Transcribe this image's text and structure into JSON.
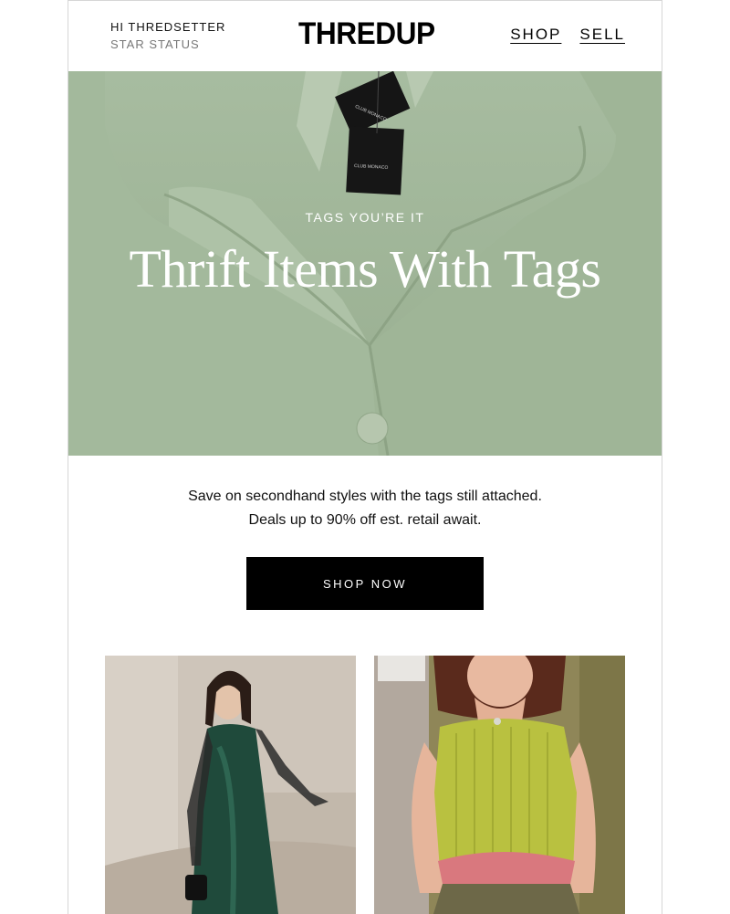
{
  "header": {
    "greeting": "HI THREDSETTER",
    "status": "STAR STATUS",
    "logo": "THREDUP",
    "nav": [
      "SHOP",
      "SELL"
    ]
  },
  "hero": {
    "eyebrow": "TAGS YOU’RE IT",
    "title": "Thrift Items With Tags",
    "tag_text": "CLUB MONACO",
    "background_color": "#9db396"
  },
  "body": {
    "line1": "Save on secondhand styles with the tags still attached.",
    "line2": "Deals up to 90% off est. retail await."
  },
  "cta": {
    "label": "SHOP NOW"
  },
  "products": [
    {
      "name": "green-slip-dress-photo"
    },
    {
      "name": "lime-knit-tank-photo"
    }
  ]
}
